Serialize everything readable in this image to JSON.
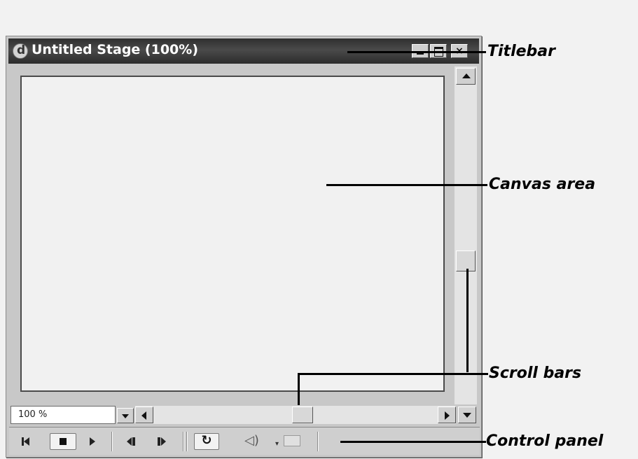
{
  "window": {
    "title": "Untitled Stage (100%)",
    "controls": {
      "minimize": "",
      "maximize": "",
      "close": "×"
    }
  },
  "zoom": {
    "value": "100 %"
  },
  "control_panel": {
    "buttons": [
      "rewind-icon",
      "stop-icon",
      "play-icon",
      "step-backward-icon",
      "step-forward-icon",
      "loop-icon",
      "volume-icon",
      "selection-icon"
    ],
    "loop_glyph": "↻",
    "volume_glyph": "◁)",
    "volume_dropdown_glyph": "▾"
  },
  "scroll": {
    "vertical_position": 0.5,
    "horizontal_position": 0.5
  },
  "callouts": {
    "titlebar": "Titlebar",
    "canvas": "Canvas area",
    "scrollbars": "Scroll bars",
    "control_panel": "Control panel"
  }
}
